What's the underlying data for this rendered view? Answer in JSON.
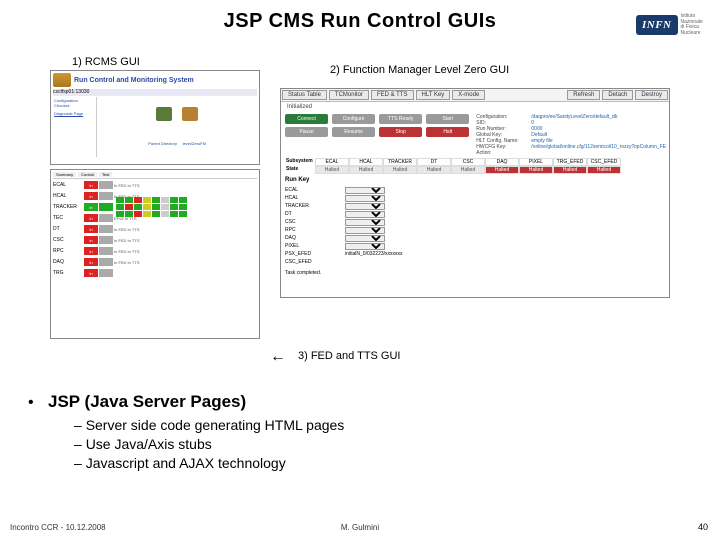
{
  "title": "JSP CMS Run Control GUIs",
  "logo": {
    "text": "INFN",
    "sub1": "Istituto Nazionale",
    "sub2": "di Fisica Nucleare"
  },
  "captions": {
    "c1": "1) RCMS GUI",
    "c2": "2) Function Manager Level Zero GUI",
    "c3": "3) FED and TTS GUI"
  },
  "panel1a": {
    "title": "Run Control and Monitoring System",
    "host": "csctfsp01:13030",
    "left": {
      "heading": "Configuration Chooser:",
      "link": "Diagnostic Page"
    },
    "bottom": {
      "left": "Parent Directory",
      "right": "level/ZeroFM"
    }
  },
  "panel1b": {
    "tabs": [
      "Summary",
      "Control",
      "Test"
    ],
    "rows": [
      {
        "name": "ECAL",
        "c1": "red",
        "c2": "gray",
        "note": "In FED  In TTS"
      },
      {
        "name": "HCAL",
        "c1": "red",
        "c2": "gray",
        "note": "In FED  In TTS"
      },
      {
        "name": "TRACKER",
        "c1": "green",
        "c2": "green",
        "matrix": true
      },
      {
        "name": "TEC",
        "c1": "red",
        "c2": "gray",
        "note": "EF≤5  In TTS"
      },
      {
        "name": "DT",
        "c1": "red",
        "c2": "gray",
        "note": "In FED  In TTS"
      },
      {
        "name": "CSC",
        "c1": "red",
        "c2": "gray",
        "note": "In FED  In TTS"
      },
      {
        "name": "RPC",
        "c1": "red",
        "c2": "gray",
        "note": "In FED  In TTS"
      },
      {
        "name": "DAQ",
        "c1": "red",
        "c2": "gray",
        "note": "In FED  In TTS"
      },
      {
        "name": "TRG",
        "c1": "red",
        "c2": "gray",
        "note": ""
      }
    ]
  },
  "panel2": {
    "tabs_left": [
      "Status Table",
      "TCMonitor",
      "FED & TTS",
      "HLT Key",
      "X-mode"
    ],
    "tabs_right": [
      "Refresh",
      "Detach",
      "Destroy"
    ],
    "status_word": "Initialized",
    "btn_rows": [
      [
        "Connect",
        "Configure",
        "TTS Ready",
        "Start"
      ],
      [
        "Pause",
        "Resume",
        "Stop",
        "Halt"
      ]
    ],
    "btn_colors": [
      [
        "green",
        "gray",
        "gray",
        "gray"
      ],
      [
        "gray",
        "gray",
        "red",
        "red"
      ]
    ],
    "info": [
      {
        "k": "Configuration:",
        "v": "/daqpro/ee/SanityLevelZero/default_db"
      },
      {
        "k": "SID:",
        "v": "0"
      },
      {
        "k": "Run Number:",
        "v": "0000"
      },
      {
        "k": "Global Key:",
        "v": "Default"
      },
      {
        "k": "HLT Config. Name:",
        "v": "empty file"
      },
      {
        "k": "HWCFG Key:",
        "v": "/online/global/online.cfg/112semicol/10_rozzyTopColumn_FE"
      },
      {
        "k": "Action:",
        "v": ""
      }
    ],
    "subsys": {
      "headers": [
        "ECAL",
        "HCAL",
        "TRACKER",
        "DT",
        "CSC",
        "DAQ",
        "PIXEL",
        "TRG_EFED",
        "CSC_EFED"
      ],
      "state_label": "State",
      "states": [
        "Halted",
        "Halted",
        "Halted",
        "Halted",
        "Halted",
        "Halted",
        "Halted",
        "Halted",
        "Halted"
      ],
      "highlight_from": 5
    },
    "runkey_label": "Run Key",
    "list": [
      "ECAL",
      "HCAL",
      "TRACKER",
      "DT",
      "CSC",
      "RPC",
      "DAQ",
      "PIXEL",
      "PSX_EFED",
      "CSC_EFED"
    ],
    "psx_value": "initialN_0/032223/xxxxxxx",
    "last_label": "Task completed."
  },
  "bullets": {
    "main": "JSP (Java Server Pages)",
    "subs": [
      "Server side code generating HTML pages",
      "Use Java/Axis stubs",
      "Javascript and AJAX technology"
    ]
  },
  "footer": {
    "left": "Incontro CCR - 10.12.2008",
    "center": "M. Gulmini",
    "page": "40"
  }
}
